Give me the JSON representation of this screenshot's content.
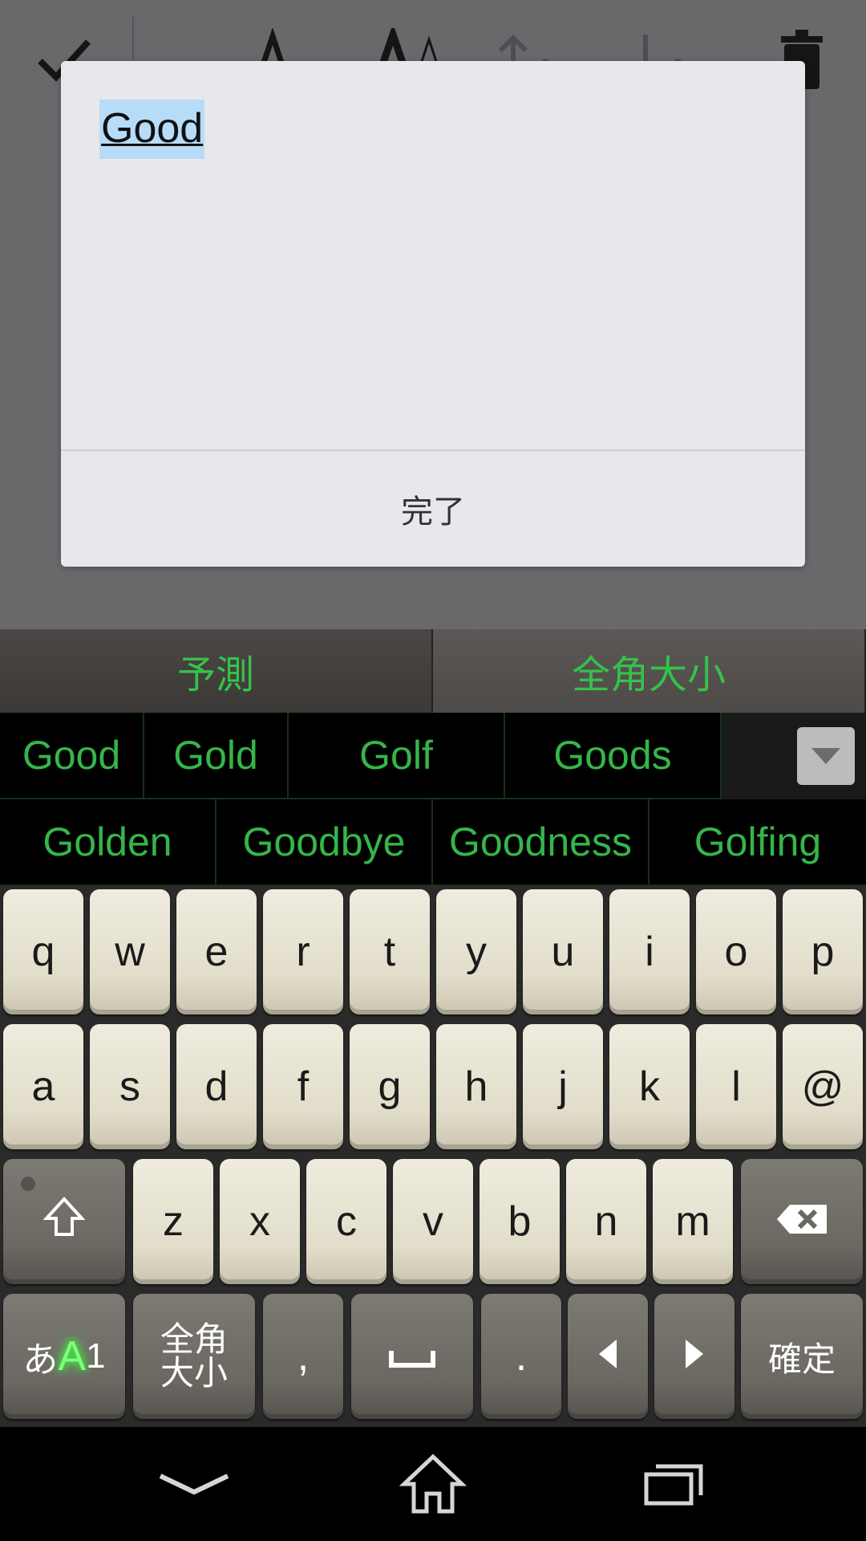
{
  "dialog": {
    "input_text": "Good",
    "done_label": "完了"
  },
  "ime": {
    "tabs": [
      {
        "label": "予測"
      },
      {
        "label": "全角大小"
      }
    ],
    "candidates_row1": [
      "Good",
      "Gold",
      "Golf",
      "Goods"
    ],
    "candidates_row2": [
      "Golden",
      "Goodbye",
      "Goodness",
      "Golfing"
    ],
    "row1": [
      "q",
      "w",
      "e",
      "r",
      "t",
      "y",
      "u",
      "i",
      "o",
      "p"
    ],
    "row2": [
      "a",
      "s",
      "d",
      "f",
      "g",
      "h",
      "j",
      "k",
      "l",
      "@"
    ],
    "row3": [
      "z",
      "x",
      "c",
      "v",
      "b",
      "n",
      "m"
    ],
    "mode_key": {
      "a": "あ",
      "b": "A",
      "c": "1"
    },
    "zenkaku_key": {
      "line1": "全角",
      "line2": "大小"
    },
    "comma": ",",
    "period": ".",
    "confirm": "確定",
    "accent_color": "#35c24a"
  },
  "icons": {
    "toolbar": [
      "check-icon",
      "font-size-small-icon",
      "font-size-large-icon",
      "move-up-icon",
      "move-down-icon",
      "trash-icon"
    ],
    "keyboard": [
      "shift-icon",
      "backspace-icon",
      "space-icon",
      "arrow-left-icon",
      "arrow-right-icon",
      "expand-candidates-icon"
    ],
    "nav": [
      "back-icon",
      "home-icon",
      "recents-icon"
    ]
  }
}
